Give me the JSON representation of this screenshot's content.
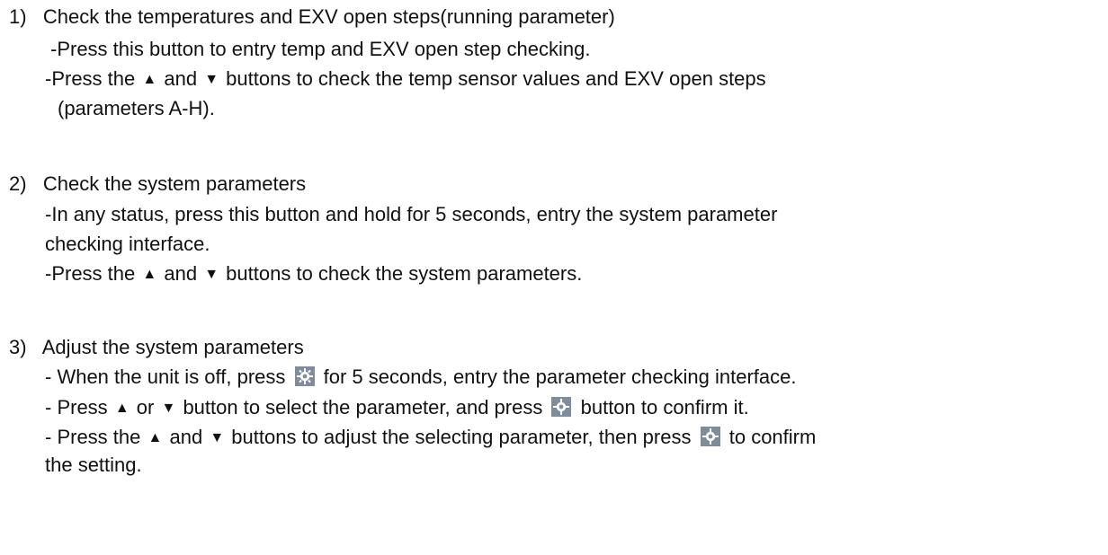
{
  "section1": {
    "number": "1)",
    "title": "Check the temperatures and EXV open steps(running parameter)",
    "l1": "-Press this button to entry temp and EXV open step checking.",
    "l2a": "-Press the",
    "l2b": "and",
    "l2c": "buttons to check the temp sensor values and EXV open steps",
    "l3": "(parameters A-H)."
  },
  "section2": {
    "number": "2)",
    "title": "Check the system parameters",
    "l1": "-In any status, press this button and hold for 5 seconds, entry the system parameter",
    "l2": "checking interface.",
    "l3a": "-Press the",
    "l3b": "and",
    "l3c": "buttons to check the system parameters."
  },
  "section3": {
    "number": "3)",
    "title": "Adjust the system parameters",
    "l1a": "- When the unit is off, press",
    "l1b": "for 5 seconds, entry the parameter checking interface.",
    "l2a": "- Press",
    "l2b": "or",
    "l2c": "button to select the parameter, and press",
    "l2d": "button to confirm it.",
    "l3a": "- Press the",
    "l3b": "and",
    "l3c": "buttons to adjust the selecting parameter, then press",
    "l3d": "to confirm",
    "l4": "the setting."
  },
  "glyphs": {
    "up": "▲",
    "down": "▼"
  },
  "icons": {
    "settings_button": "gear-button-icon"
  }
}
